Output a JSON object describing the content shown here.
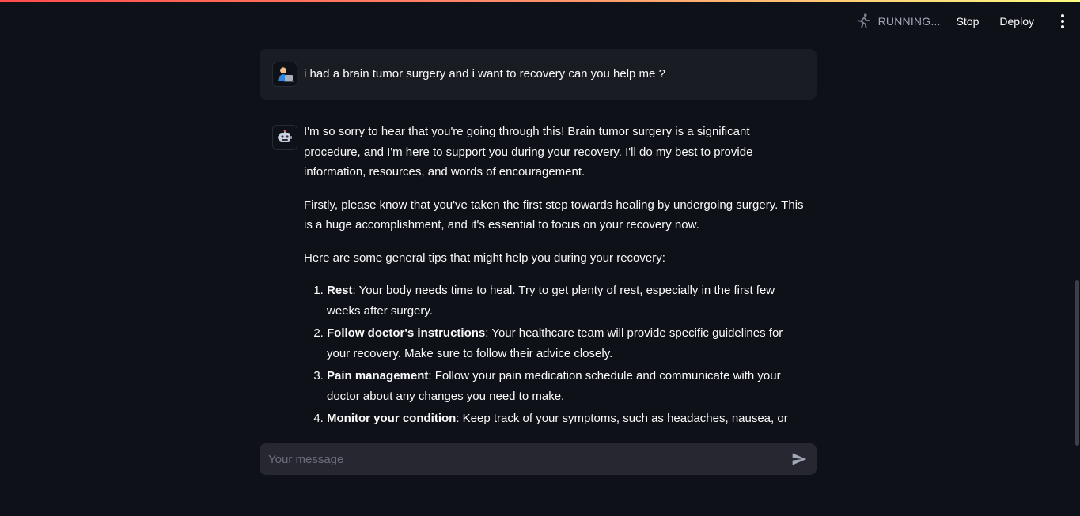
{
  "header": {
    "status_text": "RUNNING...",
    "stop_label": "Stop",
    "deploy_label": "Deploy"
  },
  "chat": {
    "user_message": "i had a brain tumor surgery and i want to recovery can you help me ?",
    "assistant": {
      "paragraphs": [
        "I'm so sorry to hear that you're going through this! Brain tumor surgery is a significant procedure, and I'm here to support you during your recovery. I'll do my best to provide information, resources, and words of encouragement.",
        "Firstly, please know that you've taken the first step towards healing by undergoing surgery. This is a huge accomplishment, and it's essential to focus on your recovery now.",
        "Here are some general tips that might help you during your recovery:"
      ],
      "tips": [
        {
          "title": "Rest",
          "text": ": Your body needs time to heal. Try to get plenty of rest, especially in the first few weeks after surgery."
        },
        {
          "title": "Follow doctor's instructions",
          "text": ": Your healthcare team will provide specific guidelines for your recovery. Make sure to follow their advice closely."
        },
        {
          "title": "Pain management",
          "text": ": Follow your pain medication schedule and communicate with your doctor about any changes you need to make."
        },
        {
          "title": "Monitor your condition",
          "text": ": Keep track of your symptoms, such as headaches, nausea, or"
        }
      ]
    }
  },
  "input": {
    "placeholder": "Your message"
  },
  "icons": {
    "user_avatar": "person-at-computer-icon",
    "assistant_avatar": "robot-icon",
    "status": "running-figure-icon",
    "send": "send-icon",
    "menu": "kebab-menu-icon"
  },
  "colors": {
    "background": "#0e1117",
    "user_bubble": "#1a1c24",
    "input_bg": "#262730",
    "text": "#fafafa",
    "muted": "#a3a8b8"
  }
}
